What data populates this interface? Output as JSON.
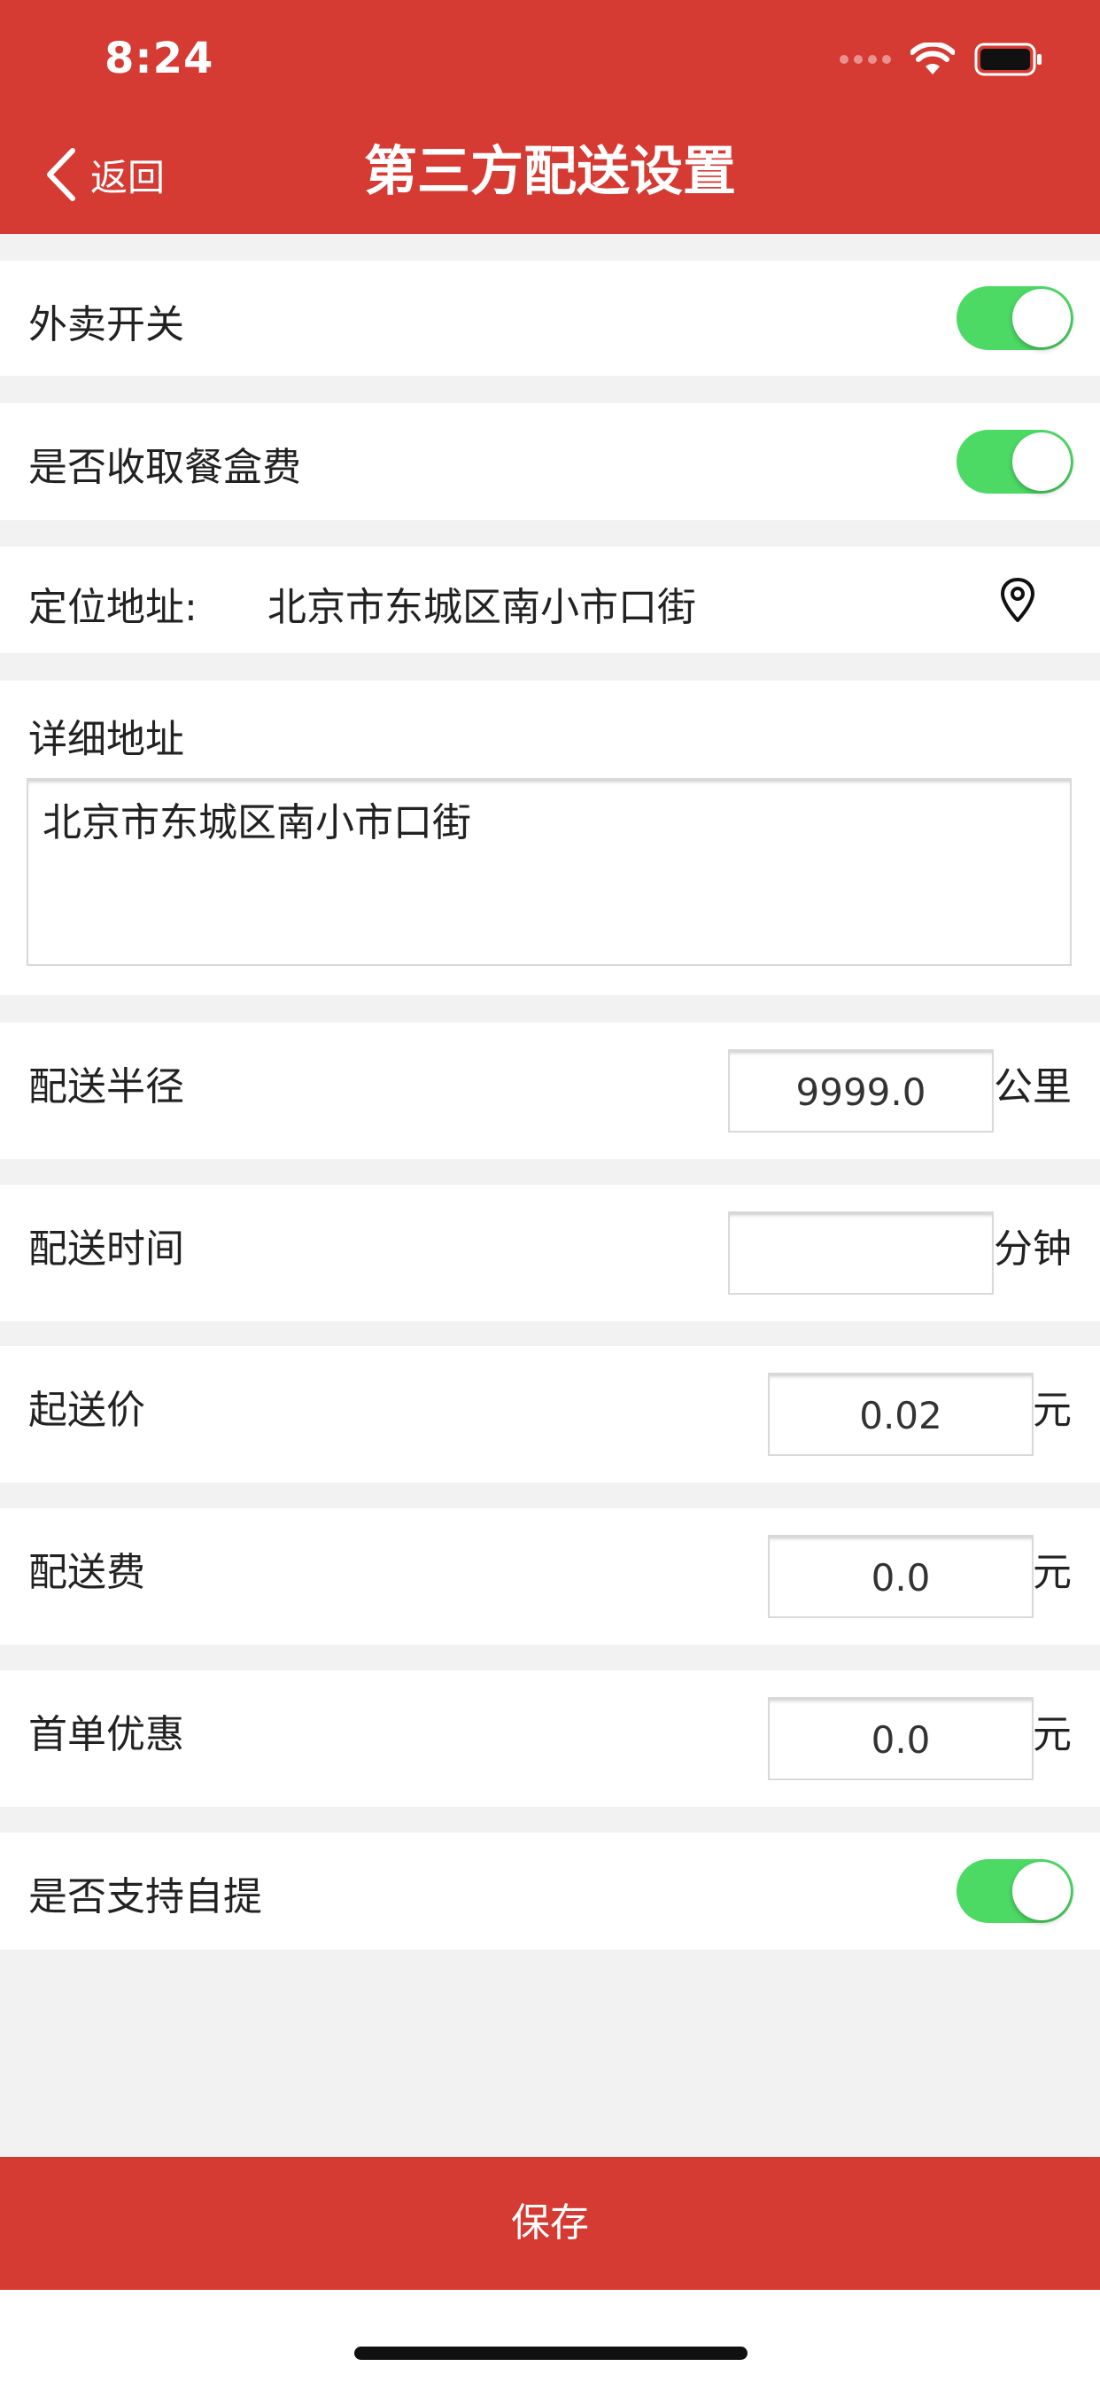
{
  "status_bar": {
    "time": "8:24"
  },
  "nav": {
    "back_label": "返回",
    "title": "第三方配送设置"
  },
  "takeout_switch": {
    "label": "外卖开关",
    "on": true
  },
  "box_fee_switch": {
    "label": "是否收取餐盒费",
    "on": true
  },
  "location": {
    "label": "定位地址:",
    "value": "北京市东城区南小市口街",
    "icon": "location-pin-icon"
  },
  "detail_address": {
    "label": "详细地址",
    "value": "北京市东城区南小市口街"
  },
  "delivery_radius": {
    "label": "配送半径",
    "value": "9999.0",
    "unit": "公里"
  },
  "delivery_time": {
    "label": "配送时间",
    "value": "",
    "unit": "分钟"
  },
  "min_order": {
    "label": "起送价",
    "value": "0.02",
    "unit": "元"
  },
  "delivery_fee": {
    "label": "配送费",
    "value": "0.0",
    "unit": "元"
  },
  "first_order_discount": {
    "label": "首单优惠",
    "value": "0.0",
    "unit": "元"
  },
  "self_pickup_switch": {
    "label": "是否支持自提",
    "on": true
  },
  "save_label": "保存",
  "colors": {
    "brand": "#d53a33",
    "toggle_on": "#4cd964",
    "background": "#f2f2f2"
  }
}
